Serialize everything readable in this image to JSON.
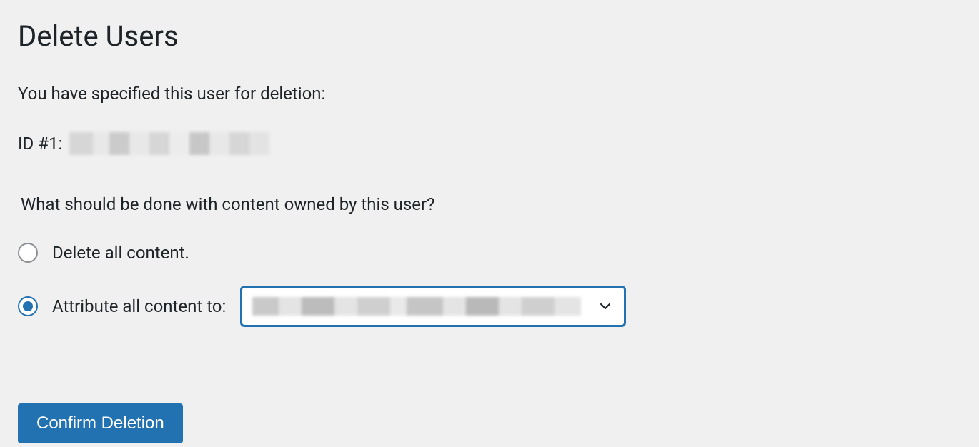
{
  "page": {
    "title": "Delete Users",
    "intro": "You have specified this user for deletion:",
    "user_id_prefix": "ID #1:",
    "question": "What should be done with content owned by this user?"
  },
  "options": {
    "delete_all": "Delete all content.",
    "attribute_to": "Attribute all content to:"
  },
  "selected_option": "attribute_to",
  "buttons": {
    "confirm": "Confirm Deletion"
  }
}
